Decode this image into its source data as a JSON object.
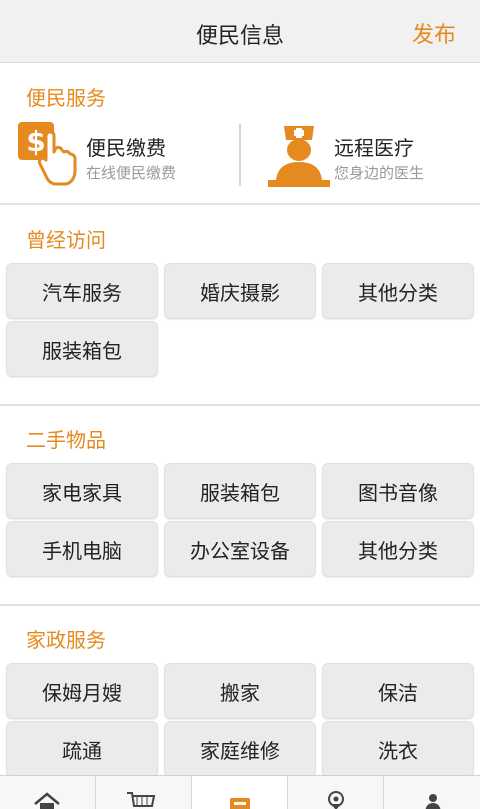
{
  "header": {
    "title": "便民信息",
    "publish_label": "发布"
  },
  "convenience": {
    "title": "便民服务",
    "items": [
      {
        "name": "便民缴费",
        "sub": "在线便民缴费",
        "icon": "payment-dollar-hand-icon"
      },
      {
        "name": "远程医疗",
        "sub": "您身边的医生",
        "icon": "nurse-doctor-icon"
      }
    ]
  },
  "visited": {
    "title": "曾经访问",
    "buttons": [
      "汽车服务",
      "婚庆摄影",
      "其他分类",
      "服装箱包"
    ]
  },
  "secondhand": {
    "title": "二手物品",
    "buttons": [
      "家电家具",
      "服装箱包",
      "图书音像",
      "手机电脑",
      "办公室设备",
      "其他分类"
    ]
  },
  "housekeeping": {
    "title": "家政服务",
    "buttons": [
      "保姆月嫂",
      "搬家",
      "保洁",
      "疏通",
      "家庭维修",
      "洗衣"
    ]
  },
  "tabbar": {
    "icons": [
      "home-icon",
      "cart-icon",
      "info-card-icon",
      "location-pin-icon",
      "person-icon"
    ]
  },
  "colors": {
    "accent": "#e58a1f",
    "button_bg": "#ebebeb",
    "header_bg": "#f1f1f1"
  }
}
